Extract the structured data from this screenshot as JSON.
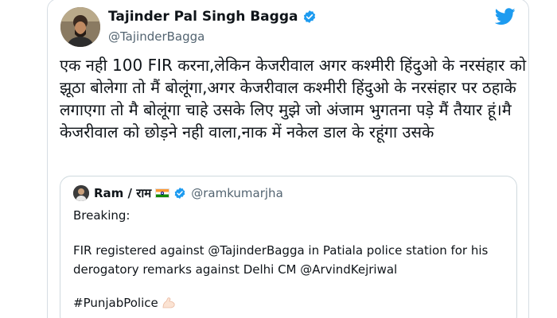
{
  "tweet": {
    "author_name": "Tajinder Pal Singh Bagga",
    "author_handle": "@TajinderBagga",
    "text": "एक नही 100 FIR करना,लेकिन केजरीवाल अगर कश्मीरी हिंदुओ के नरसंहार को झूठा बोलेगा तो मैं बोलूंगा,अगर केजरीवाल कश्मीरी हिंदुओ के नरसंहार पर ठहाके लगाएगा तो मै बोलूंगा चाहे उसके लिए मुझे जो अंजाम भुगतना पड़े मैं तैयार हूं।मै केजरीवाल को छोड़ने नही वाला,नाक में नकेल डाल के रहूंगा उसके"
  },
  "quoted_tweet": {
    "author_name": "Ram / राम",
    "author_handle": "@ramkumarjha",
    "line1": "Breaking:",
    "line2": "FIR registered against @TajinderBagga in Patiala police station for his",
    "line3": "derogatory remarks against Delhi CM @ArvindKejriwal",
    "hashtag": "#PunjabPolice"
  },
  "icons": {
    "brand": "twitter-bird-icon",
    "verified": "verified-badge-icon",
    "flag": "india-flag-icon",
    "emoji": "flexed-biceps-icon"
  },
  "colors": {
    "twitter_blue": "#1d9bf0",
    "text": "#0f1419",
    "secondary_text": "#536471",
    "border": "#cfd9de"
  }
}
